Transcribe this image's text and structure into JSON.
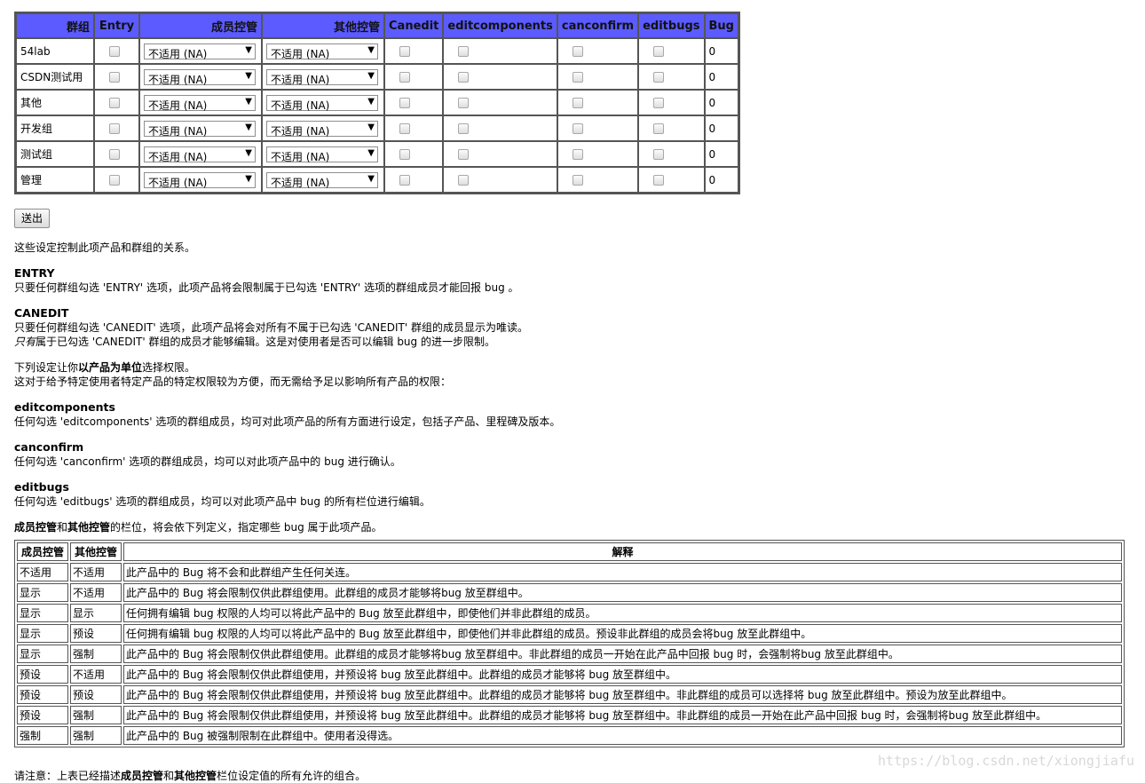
{
  "table": {
    "headers": {
      "group": "群组",
      "entry": "Entry",
      "membercontrol": "成员控管",
      "othercontrol": "其他控管",
      "canedit": "Canedit",
      "editcomponents": "editcomponents",
      "canconfirm": "canconfirm",
      "editbugs": "editbugs",
      "bug": "Bug"
    },
    "rows": [
      {
        "group": "54lab",
        "membercontrol": "不适用 (NA)",
        "othercontrol": "不适用 (NA)",
        "bug": "0"
      },
      {
        "group": "CSDN测试用",
        "membercontrol": "不适用 (NA)",
        "othercontrol": "不适用 (NA)",
        "bug": "0"
      },
      {
        "group": "其他",
        "membercontrol": "不适用 (NA)",
        "othercontrol": "不适用 (NA)",
        "bug": "0"
      },
      {
        "group": "开发组",
        "membercontrol": "不适用 (NA)",
        "othercontrol": "不适用 (NA)",
        "bug": "0"
      },
      {
        "group": "测试组",
        "membercontrol": "不适用 (NA)",
        "othercontrol": "不适用 (NA)",
        "bug": "0"
      },
      {
        "group": "管理",
        "membercontrol": "不适用 (NA)",
        "othercontrol": "不适用 (NA)",
        "bug": "0"
      }
    ]
  },
  "submit_label": "送出",
  "intro": "这些设定控制此项产品和群组的关系。",
  "entry": {
    "term": "ENTRY",
    "desc": "只要任何群组勾选 'ENTRY' 选项，此项产品将会限制属于已勾选 'ENTRY' 选项的群组成员才能回报 bug 。"
  },
  "canedit": {
    "term": "CANEDIT",
    "desc1": "只要任何群组勾选 'CANEDIT' 选项，此项产品将会对所有不属于已勾选 'CANEDIT' 群组的成员显示为唯读。",
    "desc2_em": "只有",
    "desc2_rest": "属于已勾选 'CANEDIT' 群组的成员才能够编辑。这是对使用者是否可以编辑 bug 的进一步限制。"
  },
  "perproduct": {
    "line1_pre": "下列设定让你",
    "line1_bold": "以产品为单位",
    "line1_post": "选择权限。",
    "line2": "这对于给予特定使用者特定产品的特定权限较为方便，而无需给予足以影响所有产品的权限："
  },
  "editcomponents": {
    "term": "editcomponents",
    "desc": "任何勾选 'editcomponents' 选项的群组成员，均可对此项产品的所有方面进行设定，包括子产品、里程碑及版本。"
  },
  "canconfirm": {
    "term": "canconfirm",
    "desc": "任何勾选 'canconfirm' 选项的群组成员，均可以对此项产品中的 bug 进行确认。"
  },
  "editbugs": {
    "term": "editbugs",
    "desc": "任何勾选 'editbugs' 选项的群组成员，均可以对此项产品中 bug 的所有栏位进行编辑。"
  },
  "controls_note": {
    "bold1": "成员控管",
    "and": "和",
    "bold2": "其他控管",
    "rest": "的栏位，将会依下列定义，指定哪些 bug 属于此项产品。"
  },
  "explain": {
    "headers": [
      "成员控管",
      "其他控管",
      "解释"
    ],
    "rows": [
      [
        "不适用",
        "不适用",
        "此产品中的 Bug 将不会和此群组产生任何关连。"
      ],
      [
        "显示",
        "不适用",
        "此产品中的 Bug 将会限制仅供此群组使用。此群组的成员才能够将bug 放至群组中。"
      ],
      [
        "显示",
        "显示",
        "任何拥有编辑 bug 权限的人均可以将此产品中的 Bug 放至此群组中，即使他们并非此群组的成员。"
      ],
      [
        "显示",
        "预设",
        "任何拥有编辑 bug 权限的人均可以将此产品中的 Bug 放至此群组中，即使他们并非此群组的成员。预设非此群组的成员会将bug 放至此群组中。"
      ],
      [
        "显示",
        "强制",
        "此产品中的 Bug 将会限制仅供此群组使用。此群组的成员才能够将bug 放至群组中。非此群组的成员一开始在此产品中回报 bug 时，会强制将bug 放至此群组中。"
      ],
      [
        "预设",
        "不适用",
        "此产品中的 Bug 将会限制仅供此群组使用，并预设将 bug 放至此群组中。此群组的成员才能够将 bug 放至群组中。"
      ],
      [
        "预设",
        "预设",
        "此产品中的 Bug 将会限制仅供此群组使用，并预设将 bug 放至此群组中。此群组的成员才能够将 bug 放至群组中。非此群组的成员可以选择将 bug 放至此群组中。预设为放至此群组中。"
      ],
      [
        "预设",
        "强制",
        "此产品中的 Bug 将会限制仅供此群组使用，并预设将 bug 放至此群组中。此群组的成员才能够将 bug 放至群组中。非此群组的成员一开始在此产品中回报 bug 时，会强制将bug 放至此群组中。"
      ],
      [
        "强制",
        "强制",
        "此产品中的 Bug 被强制限制在此群组中。使用者没得选。"
      ]
    ]
  },
  "footer_note": {
    "pre": "请注意：上表已经描述",
    "bold1": "成员控管",
    "and": "和",
    "bold2": "其他控管",
    "post": "栏位设定值的所有允许的组合。"
  },
  "watermark": "https://blog.csdn.net/xiongjiafu"
}
